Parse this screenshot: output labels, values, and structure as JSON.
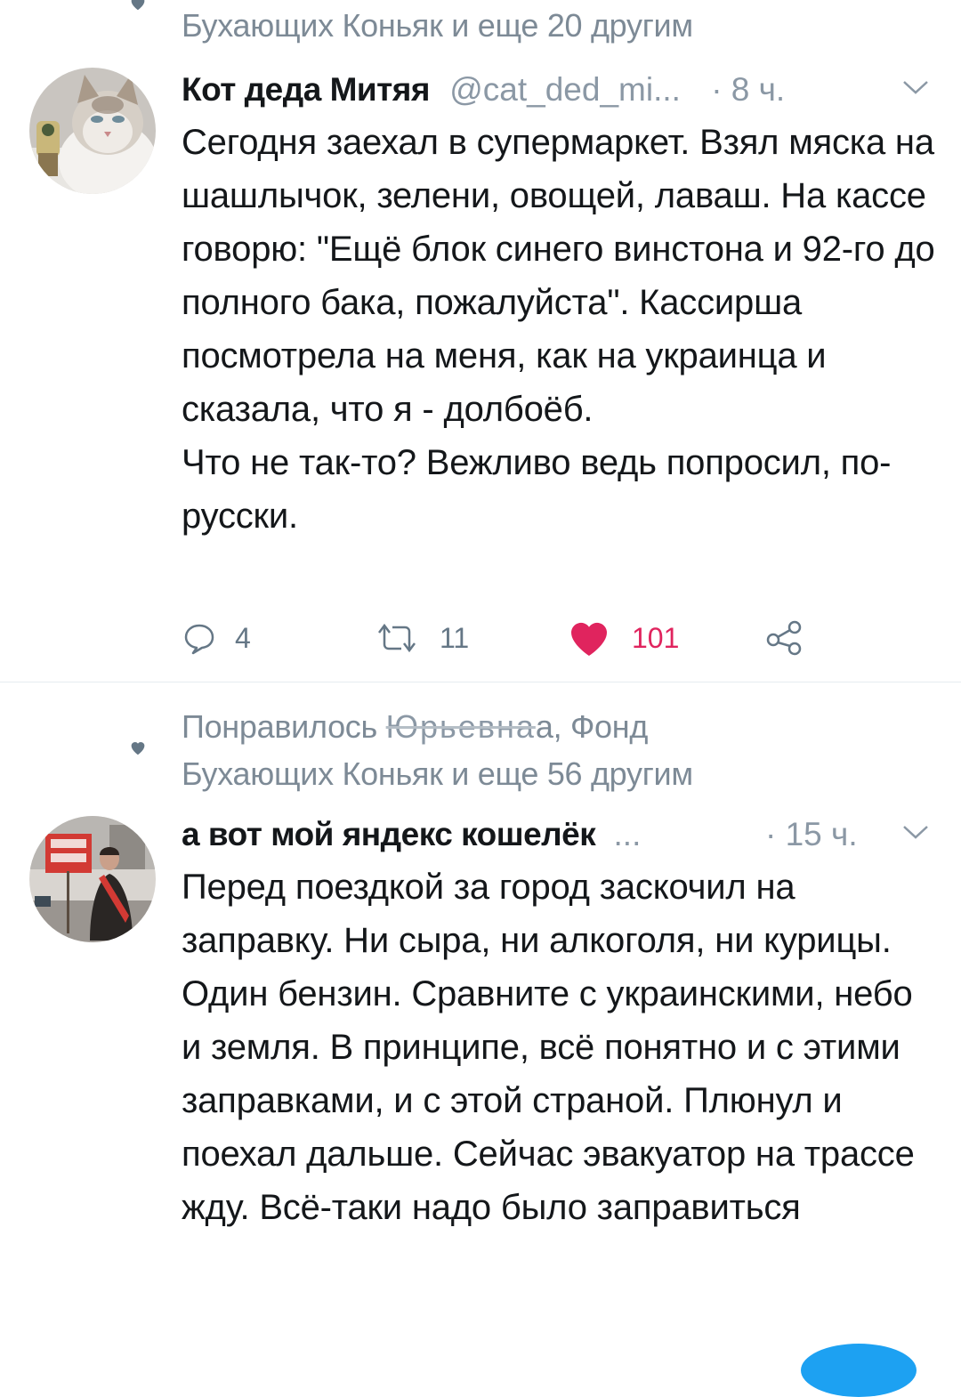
{
  "tweets": [
    {
      "social_context": "Бухающих Коньяк и еще 20 другим",
      "display_name": "Кот деда Митяя",
      "handle": "@cat_ded_mi...",
      "time": "· 8 ч.",
      "avatar_icon": "cat-avatar",
      "text": "Сегодня заехал в супермаркет. Взял мяска на шашлычок, зелени, овощей, лаваш. На кассе говорю: \"Ещё блок синего винстона и 92-го до полного бака, пожалуйста\". Кассирша посмотрела на меня, как на украинца и сказала, что я - долбоёб.\nЧто не так-то? Вежливо ведь попросил, по-русски.",
      "replies": "4",
      "retweets": "11",
      "likes": "101"
    },
    {
      "social_context_prefix": "Понравилось",
      "social_context_blurred": "Юрьевна",
      "social_context_suffix": "а, Фонд",
      "social_context_line2": "Бухающих Коньяк и еще 56 другим",
      "display_name": "а вот мой яндекс кошелёк",
      "handle": "...",
      "time": "· 15 ч.",
      "avatar_icon": "protest-photo-avatar",
      "text": "Перед поездкой за город заскочил на заправку. Ни сыра, ни алкоголя, ни курицы. Один бензин. Сравните с украинскими, небо и земля. В принципе, всё понятно и с этими заправками, и с этой страной. Плюнул и поехал дальше. Сейчас эвакуатор на трассе жду. Всё-таки надо было заправиться"
    }
  ],
  "colors": {
    "like": "#e0245e",
    "muted": "#8b98a5",
    "text": "#14171a",
    "accent": "#1da1f2"
  }
}
